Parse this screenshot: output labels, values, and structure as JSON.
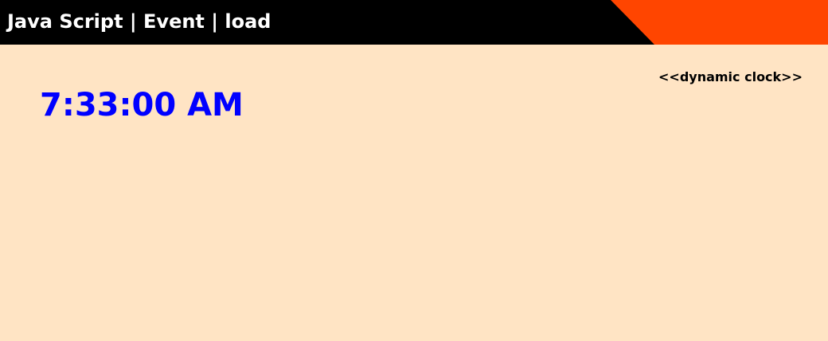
{
  "header": {
    "title": "Java Script | Event | load",
    "accent_color": "#ff4500",
    "background_color": "#000000"
  },
  "page": {
    "background_color": "#ffe4c4"
  },
  "clock": {
    "caption": "<<dynamic clock>>",
    "time": "7:33:00 AM",
    "color": "#0000ff"
  }
}
